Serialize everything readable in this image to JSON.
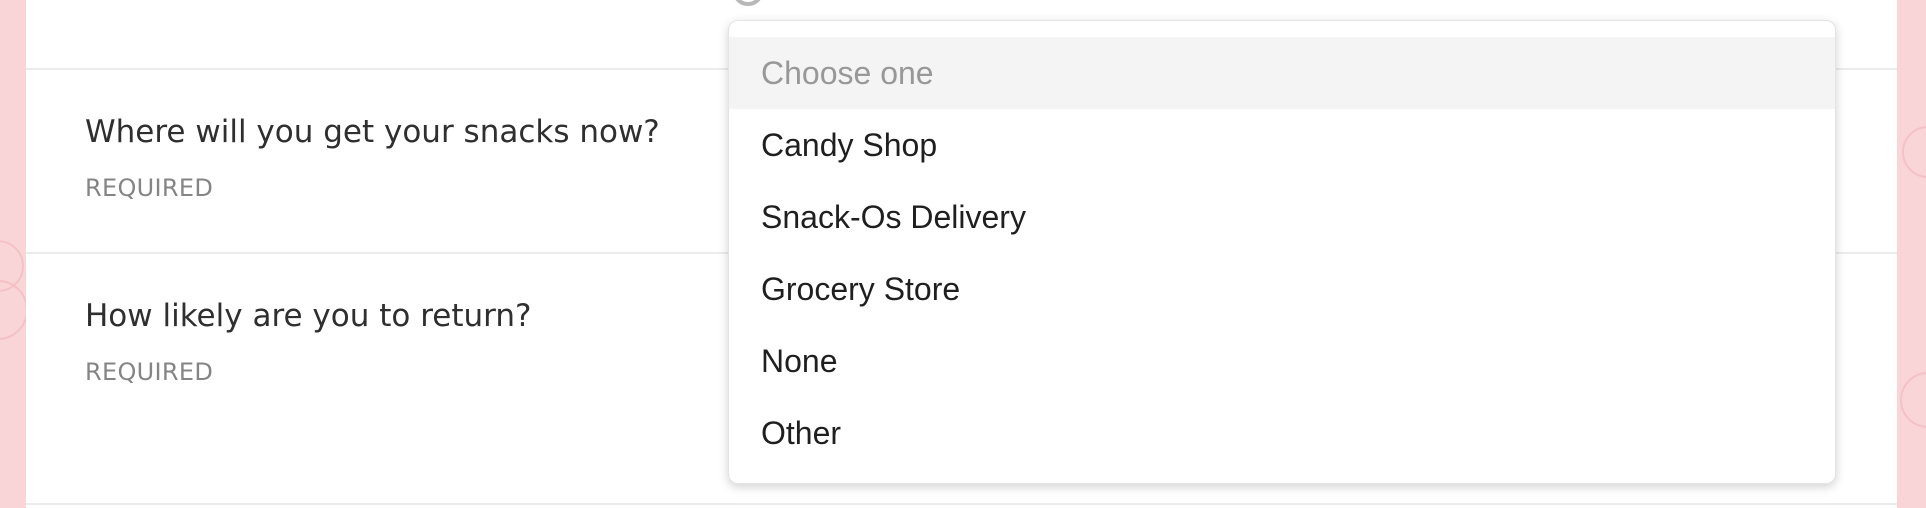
{
  "questions": [
    {
      "label": "Where will you get your snacks now?",
      "required_label": "REQUIRED"
    },
    {
      "label": "How likely are you to return?",
      "required_label": "REQUIRED"
    }
  ],
  "dropdown": {
    "placeholder": "Choose one",
    "options": [
      "Candy Shop",
      "Snack-Os Delivery",
      "Grocery Store",
      "None",
      "Other"
    ]
  },
  "colors": {
    "background": "#f9d5d8",
    "card": "#ffffff",
    "text": "#2f2f2f",
    "muted_text": "#858585",
    "placeholder_bg": "#f4f4f4",
    "placeholder_text": "#989898"
  }
}
